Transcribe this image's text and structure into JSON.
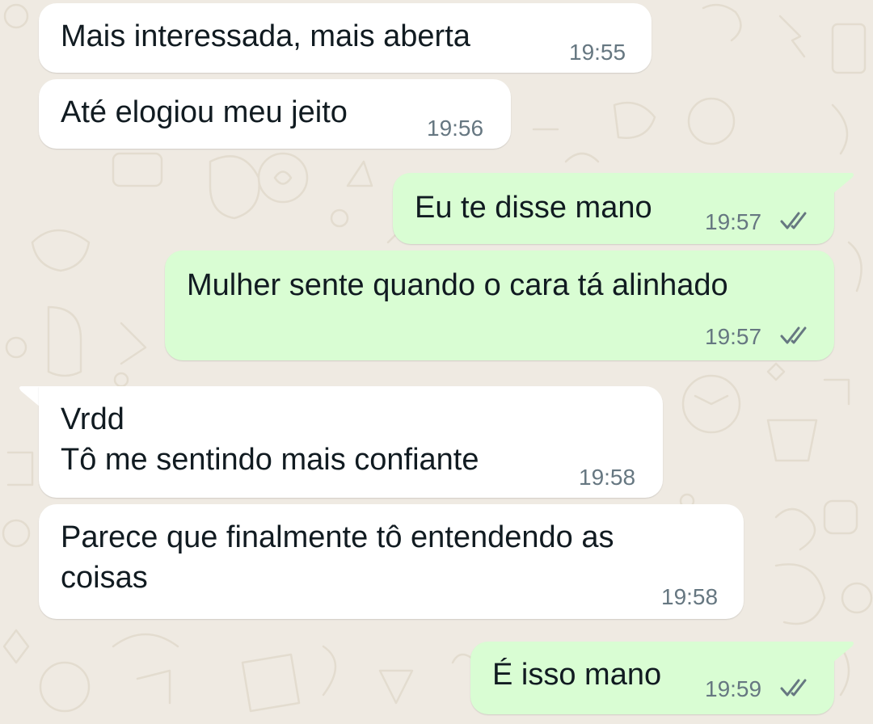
{
  "colors": {
    "wallpaper": "#efeae2",
    "incoming_bubble": "#ffffff",
    "outgoing_bubble": "#d9fdd3",
    "message_text": "#111b21",
    "timestamp": "#667781",
    "read_tick": "#667781"
  },
  "messages": [
    {
      "direction": "incoming",
      "lines": [
        "Mais interessada, mais aberta"
      ],
      "time": "19:55"
    },
    {
      "direction": "incoming",
      "lines": [
        "Até elogiou meu jeito"
      ],
      "time": "19:56"
    },
    {
      "direction": "outgoing",
      "lines": [
        "Eu te disse mano"
      ],
      "time": "19:57",
      "status_icon": "double-check-icon"
    },
    {
      "direction": "outgoing",
      "lines": [
        "Mulher sente quando o cara tá alinhado"
      ],
      "time": "19:57",
      "status_icon": "double-check-icon"
    },
    {
      "direction": "incoming",
      "lines": [
        "Vrdd",
        "Tô me sentindo mais confiante"
      ],
      "time": "19:58"
    },
    {
      "direction": "incoming",
      "lines": [
        "Parece que finalmente tô entendendo as",
        "coisas"
      ],
      "time": "19:58"
    },
    {
      "direction": "outgoing",
      "lines": [
        "É isso mano"
      ],
      "time": "19:59",
      "status_icon": "double-check-icon"
    }
  ]
}
